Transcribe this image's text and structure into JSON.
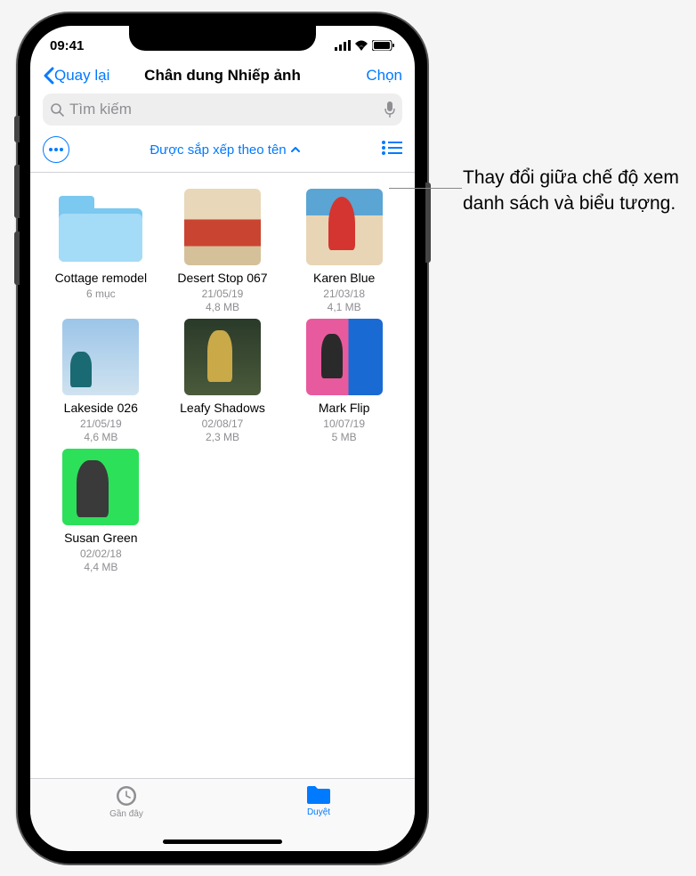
{
  "status": {
    "time": "09:41"
  },
  "nav": {
    "back": "Quay lại",
    "title": "Chân dung Nhiếp ảnh",
    "select": "Chọn"
  },
  "search": {
    "placeholder": "Tìm kiếm"
  },
  "toolbar": {
    "sort": "Được sắp xếp theo tên"
  },
  "items": [
    {
      "name": "Cottage remodel",
      "meta1": "6 mục",
      "meta2": "",
      "type": "folder"
    },
    {
      "name": "Desert Stop 067",
      "meta1": "21/05/19",
      "meta2": "4,8 MB",
      "thumb": "t1"
    },
    {
      "name": "Karen Blue",
      "meta1": "21/03/18",
      "meta2": "4,1 MB",
      "thumb": "t2"
    },
    {
      "name": "Lakeside 026",
      "meta1": "21/05/19",
      "meta2": "4,6 MB",
      "thumb": "t3"
    },
    {
      "name": "Leafy Shadows",
      "meta1": "02/08/17",
      "meta2": "2,3 MB",
      "thumb": "t4"
    },
    {
      "name": "Mark Flip",
      "meta1": "10/07/19",
      "meta2": "5 MB",
      "thumb": "t5"
    },
    {
      "name": "Susan Green",
      "meta1": "02/02/18",
      "meta2": "4,4 MB",
      "thumb": "t6"
    }
  ],
  "tabs": {
    "recent": "Gần đây",
    "browse": "Duyệt"
  },
  "callout": "Thay đổi giữa chế độ xem danh sách và biểu tượng."
}
